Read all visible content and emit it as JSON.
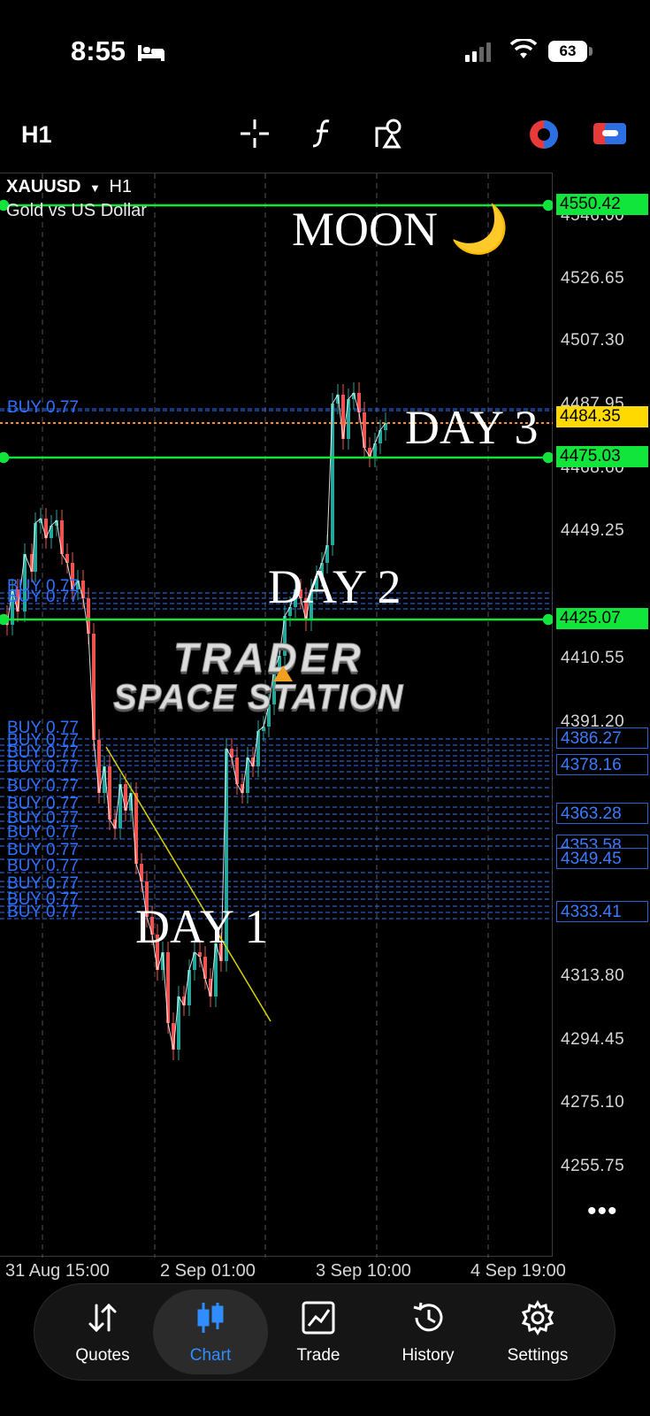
{
  "status_bar": {
    "time": "8:55",
    "battery": "63"
  },
  "toolbar": {
    "timeframe": "H1",
    "icons": [
      "crosshair-icon",
      "function-icon",
      "objects-icon",
      "one-click-trading-icon",
      "color-scheme-icon"
    ]
  },
  "symbol": {
    "name": "XAUUSD",
    "timeframe": "H1",
    "description": "Gold vs US Dollar"
  },
  "price_axis": {
    "ticks": [
      "4546.00",
      "4526.65",
      "4507.30",
      "4487.95",
      "4468.60",
      "4449.25",
      "4410.55",
      "4391.20",
      "4313.80",
      "4294.45",
      "4275.10",
      "4255.75"
    ],
    "labels": [
      {
        "value": "4550.42",
        "style": "green"
      },
      {
        "value": "4484.35",
        "style": "yellow"
      },
      {
        "value": "4475.03",
        "style": "green"
      },
      {
        "value": "4425.07",
        "style": "green"
      },
      {
        "value": "4386.27",
        "style": "blue"
      },
      {
        "value": "4378.16",
        "style": "blue"
      },
      {
        "value": "4363.28",
        "style": "blue"
      },
      {
        "value": "4353.58",
        "style": "blue"
      },
      {
        "value": "4349.45",
        "style": "blue"
      },
      {
        "value": "4333.41",
        "style": "blue"
      }
    ]
  },
  "time_axis": [
    "31 Aug 15:00",
    "2 Sep 01:00",
    "3 Sep 10:00",
    "4 Sep 19:00"
  ],
  "annotations": {
    "moon": "MOON 🌙",
    "day3": "DAY 3",
    "day2": "DAY 2",
    "day1": "DAY 1",
    "brand_top": "TRADER",
    "brand_bottom": "SPACE STATION"
  },
  "orders": {
    "label": "BUY 0.77"
  },
  "nav": {
    "items": [
      {
        "label": "Quotes",
        "icon": "quotes-icon"
      },
      {
        "label": "Chart",
        "icon": "chart-icon"
      },
      {
        "label": "Trade",
        "icon": "trade-icon"
      },
      {
        "label": "History",
        "icon": "history-icon"
      },
      {
        "label": "Settings",
        "icon": "settings-icon"
      }
    ],
    "active": "Chart"
  },
  "colors": {
    "green_line": "#11e43a",
    "bull": "#26a69a",
    "bear": "#ef5350",
    "order_line": "#2f70ff",
    "trend_line": "#d8d400"
  }
}
